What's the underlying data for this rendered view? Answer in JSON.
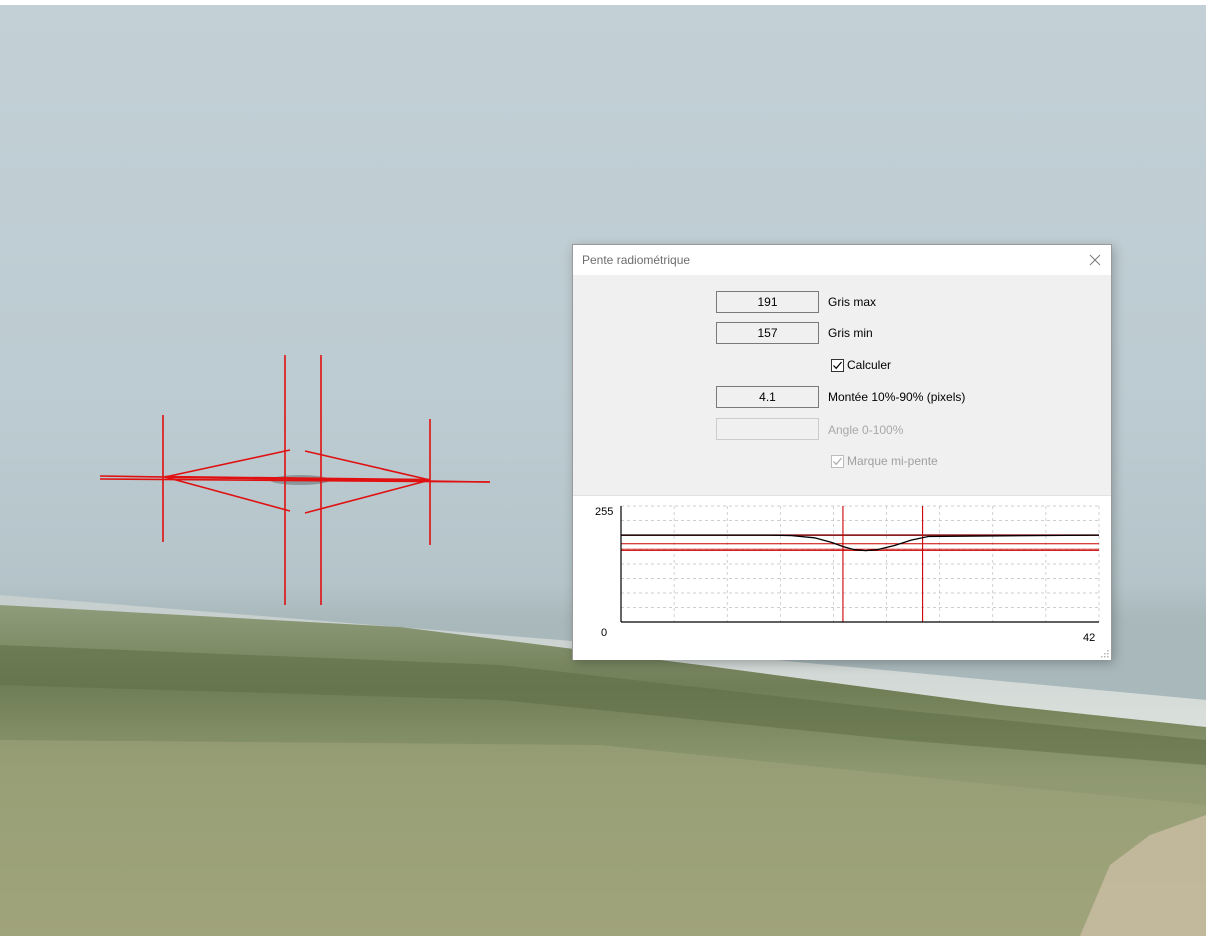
{
  "dialog": {
    "title": "Pente radiométrique",
    "fields": {
      "gris_max": {
        "value": "191",
        "label": "Gris max"
      },
      "gris_min": {
        "value": "157",
        "label": "Gris min"
      },
      "montee": {
        "value": "4.1",
        "label": "Montée 10%-90% (pixels)"
      },
      "angle": {
        "value": "",
        "label": "Angle 0-100%"
      }
    },
    "checkboxes": {
      "calculer": {
        "label": "Calculer",
        "checked": true,
        "enabled": true
      },
      "marque": {
        "label": "Marque mi-pente",
        "checked": true,
        "enabled": false
      }
    },
    "icons": {
      "close": "close-icon",
      "check": "checkmark-icon",
      "grip": "resize-grip-icon"
    }
  },
  "chart_data": {
    "type": "line",
    "x_range": [
      0,
      42
    ],
    "y_range": [
      0,
      255
    ],
    "tick_labels": {
      "y_top": "255",
      "y_bottom": "0",
      "x_right": "42"
    },
    "grid": true,
    "series": [
      {
        "x": [
          0,
          13,
          15,
          17,
          18.5,
          19.5,
          20.5,
          21.5,
          22.5,
          24,
          25.5,
          27,
          42
        ],
        "y": [
          191,
          191,
          190,
          185,
          175,
          166,
          159,
          157,
          159,
          168,
          180,
          188,
          191
        ]
      }
    ],
    "reference_lines": {
      "horizontal": [
        191,
        172,
        160,
        157
      ],
      "vertical": [
        19.5,
        26.5
      ]
    },
    "colors": {
      "curve": "#000000",
      "reference": "#cc0000",
      "dark_reference": "#7a0000",
      "grid": "#bfbfbf"
    }
  }
}
